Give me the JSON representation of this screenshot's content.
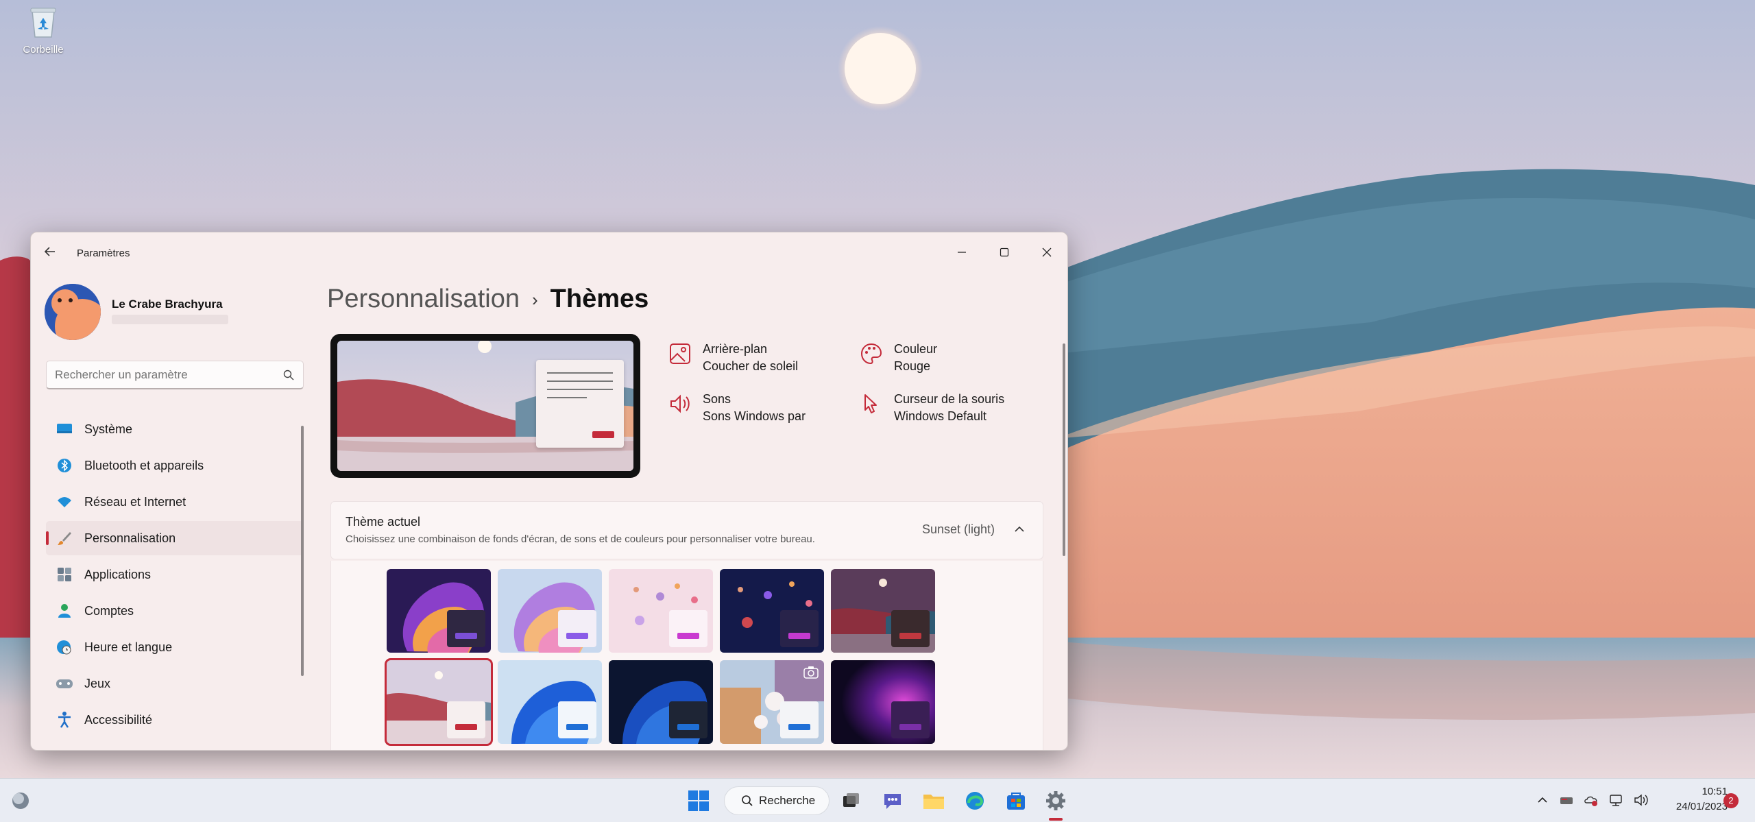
{
  "desktop": {
    "recycle_bin_label": "Corbeille"
  },
  "window": {
    "title": "Paramètres",
    "profile": {
      "name": "Le Crabe Brachyura"
    },
    "search": {
      "placeholder": "Rechercher un paramètre"
    },
    "nav": {
      "items": [
        {
          "label": "Système",
          "icon": "system-icon"
        },
        {
          "label": "Bluetooth et appareils",
          "icon": "bluetooth-icon"
        },
        {
          "label": "Réseau et Internet",
          "icon": "wifi-icon"
        },
        {
          "label": "Personnalisation",
          "icon": "brush-icon",
          "active": true
        },
        {
          "label": "Applications",
          "icon": "apps-icon"
        },
        {
          "label": "Comptes",
          "icon": "person-icon"
        },
        {
          "label": "Heure et langue",
          "icon": "globe-clock-icon"
        },
        {
          "label": "Jeux",
          "icon": "gamepad-icon"
        },
        {
          "label": "Accessibilité",
          "icon": "accessibility-icon"
        }
      ]
    },
    "breadcrumb": {
      "parent": "Personnalisation",
      "separator": "›",
      "current": "Thèmes"
    },
    "attributes": {
      "background": {
        "title": "Arrière-plan",
        "value": "Coucher de soleil"
      },
      "color": {
        "title": "Couleur",
        "value": "Rouge"
      },
      "sounds": {
        "title": "Sons",
        "value": "Sons Windows par"
      },
      "cursor": {
        "title": "Curseur de la souris",
        "value": "Windows Default"
      }
    },
    "current_theme": {
      "title": "Thème actuel",
      "description": "Choisissez une combinaison de fonds d'écran, de sons et de couleurs pour personnaliser votre bureau.",
      "value": "Sunset (light)"
    },
    "themes": [
      {
        "name": "theme-glow-dark",
        "accent": "#7b4fd6"
      },
      {
        "name": "theme-glow-light",
        "accent": "#8a5be8"
      },
      {
        "name": "theme-planets-light",
        "accent": "#c93ad0"
      },
      {
        "name": "theme-planets-dark",
        "accent": "#c23ad0"
      },
      {
        "name": "theme-sunset-dark",
        "accent": "#c0383f"
      },
      {
        "name": "theme-sunset-light",
        "accent": "#c42b3a",
        "selected": true
      },
      {
        "name": "theme-bloom-light",
        "accent": "#1f6fd6"
      },
      {
        "name": "theme-bloom-dark",
        "accent": "#1f6fd6"
      },
      {
        "name": "theme-flowers",
        "accent": "#1f6fd6"
      },
      {
        "name": "theme-dark-glow-purple",
        "accent": "#7a2fa8"
      }
    ]
  },
  "taskbar": {
    "search_label": "Recherche",
    "time": "10:51",
    "date": "24/01/2023",
    "notification_count": "2"
  },
  "colors": {
    "accent": "#c42b3a"
  }
}
